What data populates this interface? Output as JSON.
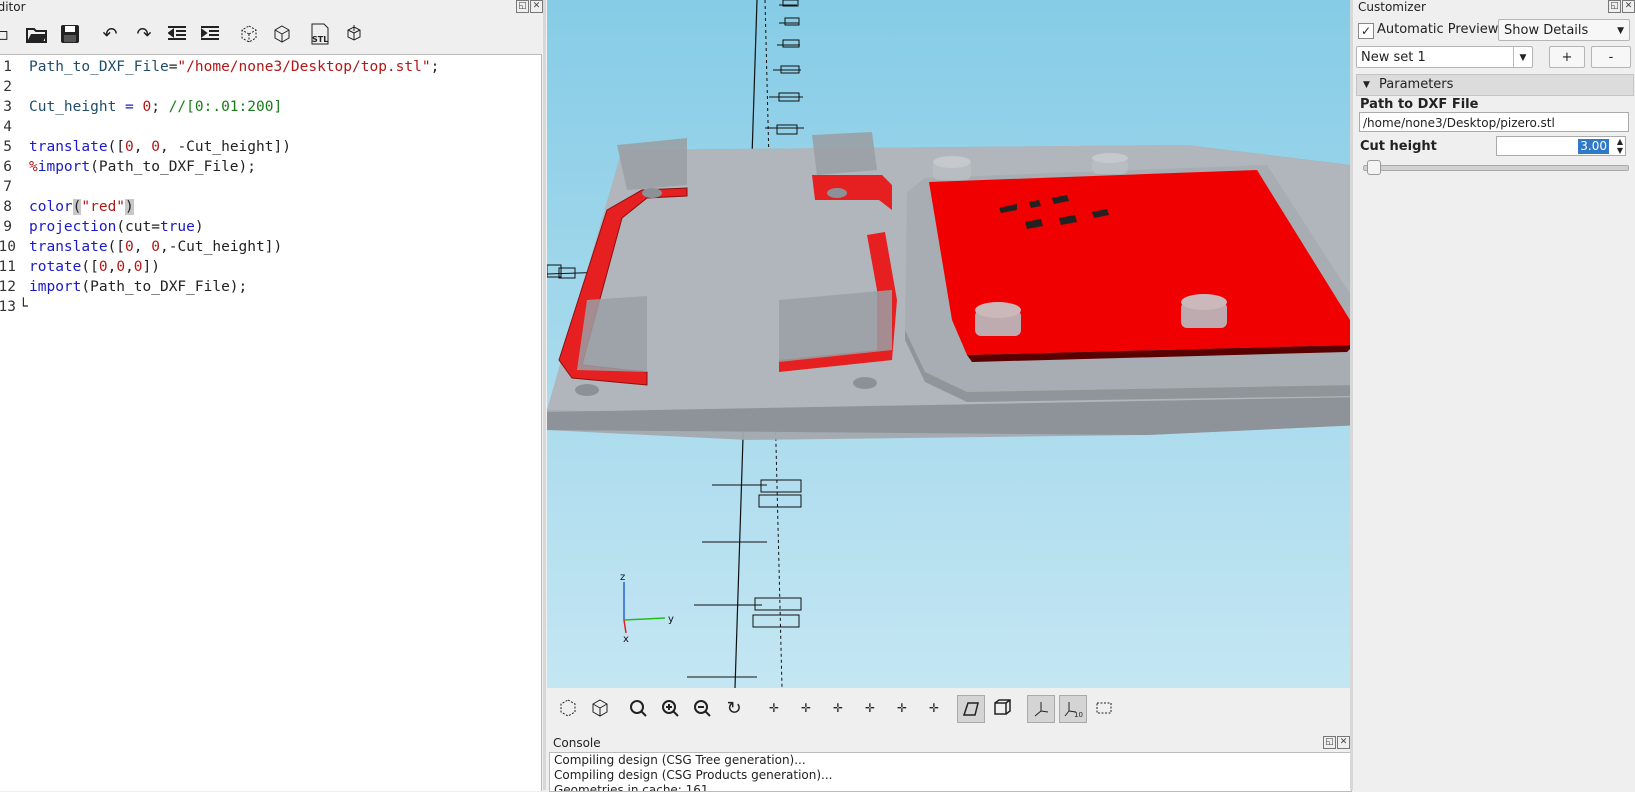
{
  "editor": {
    "title": "Editor",
    "code_lines": [
      {
        "n": "1",
        "tokens": [
          {
            "t": "Path_to_DXF_File",
            "c": "id"
          },
          {
            "t": "=",
            "c": ""
          },
          {
            "t": "\"/home/none3/Desktop/top.stl\"",
            "c": "str"
          },
          {
            "t": ";",
            "c": ""
          }
        ]
      },
      {
        "n": "2",
        "tokens": []
      },
      {
        "n": "3",
        "tokens": [
          {
            "t": "Cut_height ",
            "c": "id"
          },
          {
            "t": "= ",
            "c": "kw"
          },
          {
            "t": "0",
            "c": "num"
          },
          {
            "t": "; ",
            "c": ""
          },
          {
            "t": "//[0:.01:200]",
            "c": "com"
          }
        ]
      },
      {
        "n": "4",
        "tokens": []
      },
      {
        "n": "5",
        "tokens": [
          {
            "t": "translate",
            "c": "kw"
          },
          {
            "t": "([",
            "c": ""
          },
          {
            "t": "0",
            "c": "num"
          },
          {
            "t": ", ",
            "c": ""
          },
          {
            "t": "0",
            "c": "num"
          },
          {
            "t": ", -Cut_height])",
            "c": ""
          }
        ]
      },
      {
        "n": "6",
        "tokens": [
          {
            "t": "%",
            "c": "str"
          },
          {
            "t": "import",
            "c": "kw"
          },
          {
            "t": "(Path_to_DXF_File);",
            "c": ""
          }
        ]
      },
      {
        "n": "7",
        "tokens": []
      },
      {
        "n": "8",
        "tokens": [
          {
            "t": "color",
            "c": "kw"
          },
          {
            "t": "(",
            "c": "br"
          },
          {
            "t": "\"red\"",
            "c": "str"
          },
          {
            "t": ")",
            "c": "br"
          }
        ]
      },
      {
        "n": "9",
        "tokens": [
          {
            "t": "projection",
            "c": "kw"
          },
          {
            "t": "(cut=",
            "c": ""
          },
          {
            "t": "true",
            "c": "kw"
          },
          {
            "t": ")",
            "c": ""
          }
        ]
      },
      {
        "n": "10",
        "tokens": [
          {
            "t": "translate",
            "c": "kw"
          },
          {
            "t": "([",
            "c": ""
          },
          {
            "t": "0",
            "c": "num"
          },
          {
            "t": ", ",
            "c": ""
          },
          {
            "t": "0",
            "c": "num"
          },
          {
            "t": ",-Cut_height])",
            "c": ""
          }
        ]
      },
      {
        "n": "11",
        "tokens": [
          {
            "t": "rotate",
            "c": "kw"
          },
          {
            "t": "([",
            "c": ""
          },
          {
            "t": "0",
            "c": "num"
          },
          {
            "t": ",",
            "c": ""
          },
          {
            "t": "0",
            "c": "num"
          },
          {
            "t": ",",
            "c": ""
          },
          {
            "t": "0",
            "c": "num"
          },
          {
            "t": "])",
            "c": ""
          }
        ]
      },
      {
        "n": "12",
        "tokens": [
          {
            "t": "import",
            "c": "kw"
          },
          {
            "t": "(Path_to_DXF_File);",
            "c": ""
          }
        ]
      },
      {
        "n": "13",
        "tokens": [
          {
            "t": "└",
            "c": ""
          }
        ]
      }
    ]
  },
  "axes": {
    "z": "z",
    "y": "y",
    "x": "x"
  },
  "console": {
    "title": "Console",
    "lines": [
      "Compiling design (CSG Tree generation)...",
      "Compiling design (CSG Products generation)...",
      "Geometries in cache: 161"
    ]
  },
  "customizer": {
    "title": "Customizer",
    "auto_preview_label": "Automatic Preview",
    "auto_preview_checked": true,
    "details_select": "Show Details",
    "set_select": "New set 1",
    "add_label": "+",
    "remove_label": "-",
    "section_label": "Parameters",
    "param1_label": "Path to DXF File",
    "param1_value": "/home/none3/Desktop/pizero.stl",
    "param2_label": "Cut height",
    "param2_value": "3.00",
    "slider_fraction": 0.015
  },
  "colors": {
    "accent": "#3078c8",
    "model_red": "#f00000",
    "model_gray": "#a7adb2",
    "sky_top": "#86cce6"
  }
}
